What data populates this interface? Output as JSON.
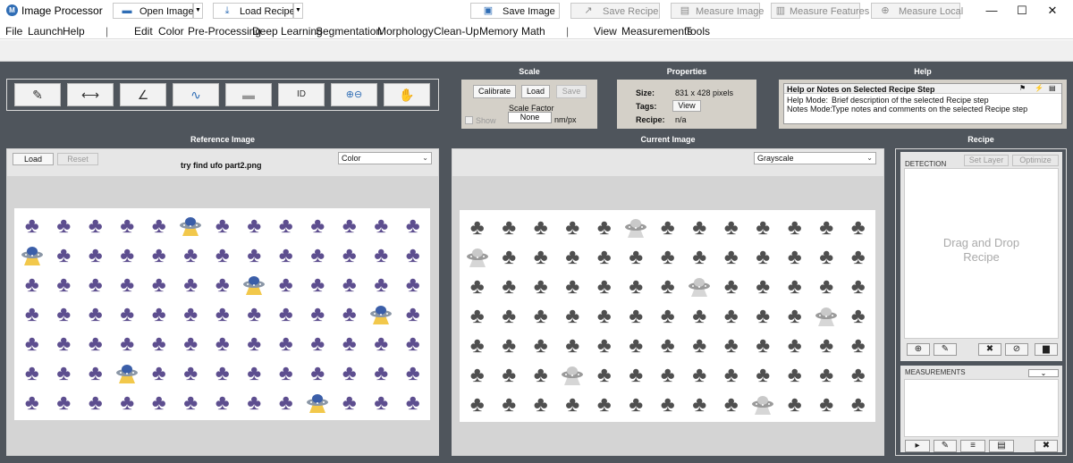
{
  "window": {
    "title": "Image Processor",
    "minimize_icon": "—",
    "maximize_icon": "☐",
    "close_icon": "✕"
  },
  "menu": [
    "File",
    "Launch",
    "Help",
    "|",
    "Edit",
    "Color",
    "Pre-Processing",
    "Deep Learning",
    "Segmentation",
    "Morphology",
    "Clean-Up",
    "Memory",
    "Math",
    "|",
    "View",
    "Measurements",
    "Tools"
  ],
  "toolbar": {
    "open_image": "Open Image",
    "load_recipe": "Load Recipe",
    "save_image": "Save Image",
    "save_recipe": "Save Recipe",
    "measure_image": "Measure Image",
    "measure_features": "Measure Features",
    "measure_local": "Measure Local"
  },
  "tools": [
    {
      "name": "eyedropper-icon",
      "glyph": "✎"
    },
    {
      "name": "distance-icon",
      "glyph": "⟷"
    },
    {
      "name": "angle-icon",
      "glyph": "∠"
    },
    {
      "name": "profile-icon",
      "glyph": "∿"
    },
    {
      "name": "ruler-icon",
      "glyph": "▬"
    },
    {
      "name": "id-icon",
      "glyph": "ID"
    },
    {
      "name": "zoom-icon",
      "glyph": "⊕⊖"
    },
    {
      "name": "pan-icon",
      "glyph": "✋"
    }
  ],
  "scale": {
    "header": "Scale",
    "calibrate": "Calibrate",
    "load": "Load",
    "save": "Save",
    "show": "Show",
    "factor_label": "Scale Factor",
    "factor_value": "None",
    "unit": "nm/px"
  },
  "properties": {
    "header": "Properties",
    "size_label": "Size:",
    "size_value": "831 x 428 pixels",
    "tags_label": "Tags:",
    "tags_button": "View",
    "recipe_label": "Recipe:",
    "recipe_value": "n/a"
  },
  "help": {
    "header": "Help",
    "title": "Help or Notes on Selected Recipe Step",
    "help_mode_label": "Help Mode:",
    "help_mode_text": "Brief description of the selected Recipe step",
    "notes_mode_label": "Notes Mode:",
    "notes_mode_text": "Type notes and comments on the selected Recipe step"
  },
  "reference": {
    "header": "Reference Image",
    "load": "Load",
    "reset": "Reset",
    "filename": "try find ufo part2.png",
    "mode": "Color"
  },
  "current": {
    "header": "Current Image",
    "mode": "Grayscale"
  },
  "recipe": {
    "header": "Recipe",
    "detection": "DETECTION",
    "set_layer": "Set Layer",
    "optimize": "Optimize",
    "placeholder_line1": "Drag and Drop",
    "placeholder_line2": "Recipe",
    "measurements": "MEASUREMENTS"
  },
  "image_grid": {
    "rows": 7,
    "cols": 13,
    "club_glyph": "♣",
    "ufo_positions": [
      [
        0,
        5
      ],
      [
        1,
        0
      ],
      [
        2,
        7
      ],
      [
        3,
        11
      ],
      [
        5,
        3
      ],
      [
        6,
        9
      ]
    ],
    "reference_color": "#5d4e8f",
    "current_color": "#4f4f4f"
  }
}
